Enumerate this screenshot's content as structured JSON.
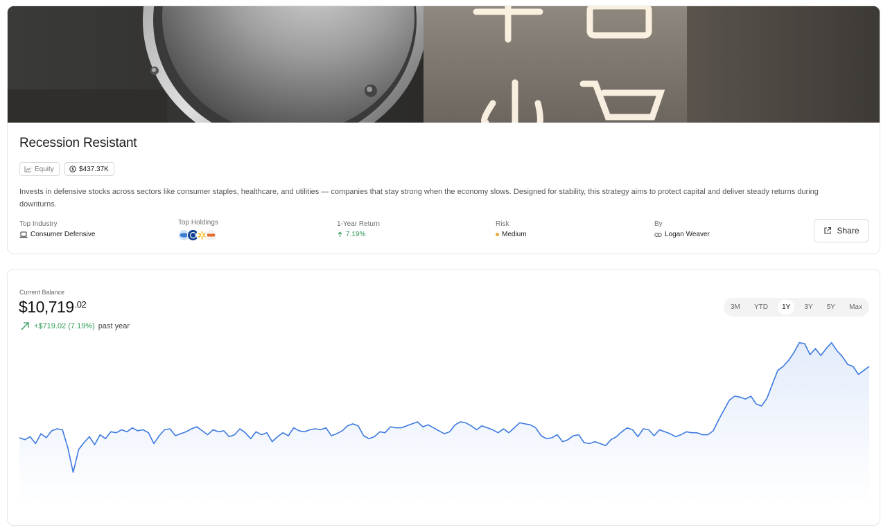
{
  "strategy": {
    "title": "Recession Resistant",
    "asset_class_tag": "Equity",
    "aum_tag": "$437.37K",
    "description": "Invests in defensive stocks across sectors like consumer staples, healthcare, and utilities — companies that stay strong when the economy slows. Designed for stability, this strategy aims to protect capital and deliver steady returns during downturns.",
    "meta": {
      "industry_label": "Top Industry",
      "industry_value": "Consumer Defensive",
      "holdings_label": "Top Holdings",
      "return_label": "1-Year Return",
      "return_value": "7.19%",
      "risk_label": "Risk",
      "risk_value": "Medium",
      "by_label": "By",
      "by_value": "Logan Weaver"
    },
    "share_label": "Share"
  },
  "balance": {
    "label": "Current Balance",
    "dollars": "$10,719",
    "cents": ".02",
    "change_amount": "+$719.02 (7.19%)",
    "change_period": "past year"
  },
  "ranges": [
    "3M",
    "YTD",
    "1Y",
    "3Y",
    "5Y",
    "Max"
  ],
  "active_range": "1Y",
  "colors": {
    "accent_line": "#3b78e0",
    "positive": "#2e9b55",
    "risk_medium": "#e8a93a"
  },
  "chart_data": {
    "type": "area",
    "series": [
      {
        "values": [
          10000,
          9980,
          10010,
          9940,
          10040,
          10000,
          10070,
          10090,
          10080,
          9900,
          9650,
          9880,
          9950,
          10010,
          9930,
          10030,
          9990,
          10060,
          10050,
          10080,
          10060,
          10100,
          10070,
          10080,
          10050,
          9940,
          10020,
          10080,
          10090,
          10020,
          10040,
          10060,
          10090,
          10110,
          10070,
          10030,
          10080,
          10060,
          10070,
          10010,
          10030,
          10090,
          10050,
          9990,
          10060,
          10030,
          10050,
          9960,
          10010,
          10050,
          10020,
          10100,
          10070,
          10060,
          10080,
          10090,
          10080,
          10100,
          10020,
          10040,
          10070,
          10120,
          10140,
          10120,
          10020,
          9990,
          10010,
          10060,
          10050,
          10110,
          10100,
          10100,
          10120,
          10140,
          10160,
          10110,
          10130,
          10100,
          10070,
          10040,
          10060,
          10130,
          10160,
          10150,
          10120,
          10080,
          10120,
          10100,
          10080,
          10050,
          10090,
          10050,
          10100,
          10150,
          10140,
          10130,
          10100,
          10020,
          9990,
          10000,
          10030,
          9960,
          9980,
          10020,
          10030,
          9950,
          9940,
          9960,
          9940,
          9920,
          9980,
          10010,
          10060,
          10100,
          10080,
          10010,
          10090,
          10080,
          10020,
          10080,
          10060,
          10040,
          10010,
          10030,
          10060,
          10050,
          10050,
          10030,
          10030,
          10070,
          10180,
          10280,
          10380,
          10420,
          10410,
          10390,
          10420,
          10340,
          10320,
          10400,
          10540,
          10680,
          10720,
          10780,
          10860,
          10960,
          10950,
          10840,
          10900,
          10830,
          10900,
          10960,
          10880,
          10820,
          10740,
          10720,
          10640,
          10680,
          10719.02
        ]
      }
    ],
    "x_range": "past year",
    "ylim": [
      9600,
      11000
    ],
    "grid": false,
    "legend": "none"
  }
}
